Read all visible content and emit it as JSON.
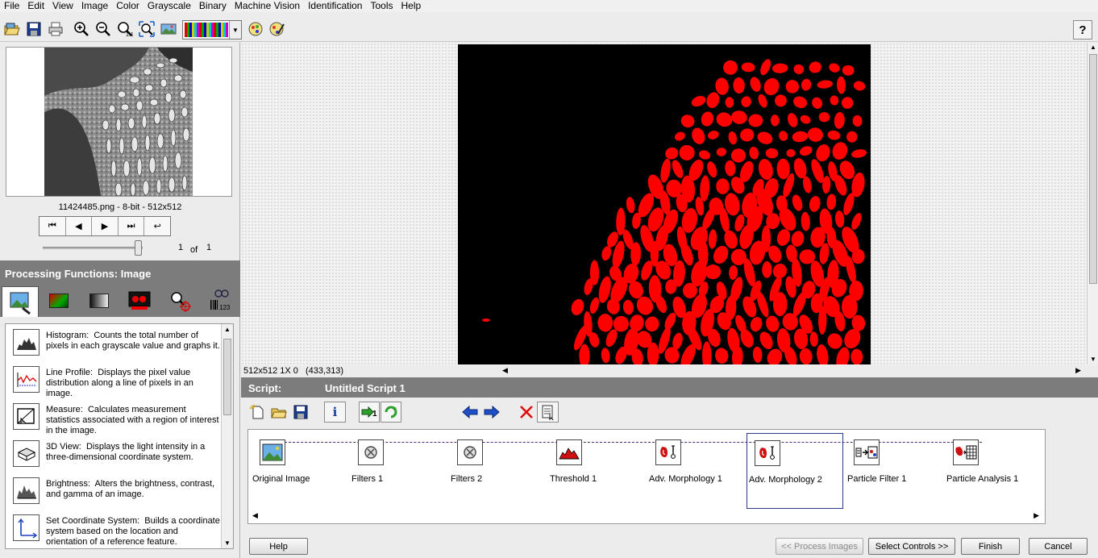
{
  "menubar": [
    "File",
    "Edit",
    "View",
    "Image",
    "Color",
    "Grayscale",
    "Binary",
    "Machine Vision",
    "Identification",
    "Tools",
    "Help"
  ],
  "toolbar": {
    "icons": [
      "open-image-icon",
      "save-image-icon",
      "print-icon",
      "zoom-in-icon",
      "zoom-out-icon",
      "zoom-1to1-icon",
      "zoom-fit-icon",
      "image-view-icon",
      "palette-selector",
      "script-run-icon",
      "script-edit-icon",
      "help-icon"
    ]
  },
  "browser": {
    "caption": "11424485.png - 8-bit - 512x512",
    "page_current": "1",
    "page_of": "of",
    "page_total": "1",
    "slider_fraction": 1.0
  },
  "processing": {
    "header": "Processing Functions: Image",
    "tabs": [
      "image-tab-icon",
      "color-tab-icon",
      "grayscale-tab-icon",
      "binary-tab-icon",
      "machine-vision-tab-icon",
      "identification-tab-icon"
    ],
    "items": [
      {
        "name": "Histogram:",
        "desc": "Counts the total number of pixels in each grayscale value and graphs it.",
        "icon": "histogram-icon"
      },
      {
        "name": "Line Profile:",
        "desc": "Displays the pixel value distribution along a line of pixels in an image.",
        "icon": "line-profile-icon"
      },
      {
        "name": "Measure:",
        "desc": "Calculates measurement statistics associated with a region of interest in the image.",
        "icon": "measure-icon"
      },
      {
        "name": "3D View:",
        "desc": "Displays the light intensity in a three-dimensional coordinate system.",
        "icon": "3d-view-icon"
      },
      {
        "name": "Brightness:",
        "desc": "Alters the brightness, contrast, and gamma of an image.",
        "icon": "brightness-icon"
      },
      {
        "name": "Set Coordinate System:",
        "desc": "Builds a coordinate system based on the location and orientation of a reference feature.",
        "icon": "coordinate-system-icon"
      }
    ]
  },
  "image_view": {
    "size_text": "512x512 1X 0",
    "coord_text": "(433,313)"
  },
  "script": {
    "label": "Script:",
    "name": "Untitled Script 1",
    "toolbar_icons": [
      "new-script-icon",
      "open-script-icon",
      "save-script-icon",
      "info-icon",
      "run-once-icon",
      "run-loop-icon",
      "move-left-icon",
      "move-right-icon",
      "delete-step-icon",
      "step-properties-icon"
    ],
    "steps": [
      {
        "label": "Original Image",
        "icon": "original-image-icon"
      },
      {
        "label": "Filters 1",
        "icon": "filter-icon"
      },
      {
        "label": "Filters 2",
        "icon": "filter-icon"
      },
      {
        "label": "Threshold 1",
        "icon": "threshold-icon"
      },
      {
        "label": "Adv. Morphology 1",
        "icon": "adv-morphology-icon"
      },
      {
        "label": "Adv. Morphology 2",
        "icon": "adv-morphology-icon",
        "selected": true
      },
      {
        "label": "Particle Filter 1",
        "icon": "particle-filter-icon"
      },
      {
        "label": "Particle Analysis 1",
        "icon": "particle-analysis-icon"
      }
    ]
  },
  "buttons": {
    "help": "Help",
    "process_images": "<< Process Images",
    "select_controls": "Select Controls >>",
    "finish": "Finish",
    "cancel": "Cancel"
  },
  "colors": {
    "particles": "#ff0000",
    "panel_header": "#7c7c7c",
    "selection": "#2c3c8c"
  }
}
